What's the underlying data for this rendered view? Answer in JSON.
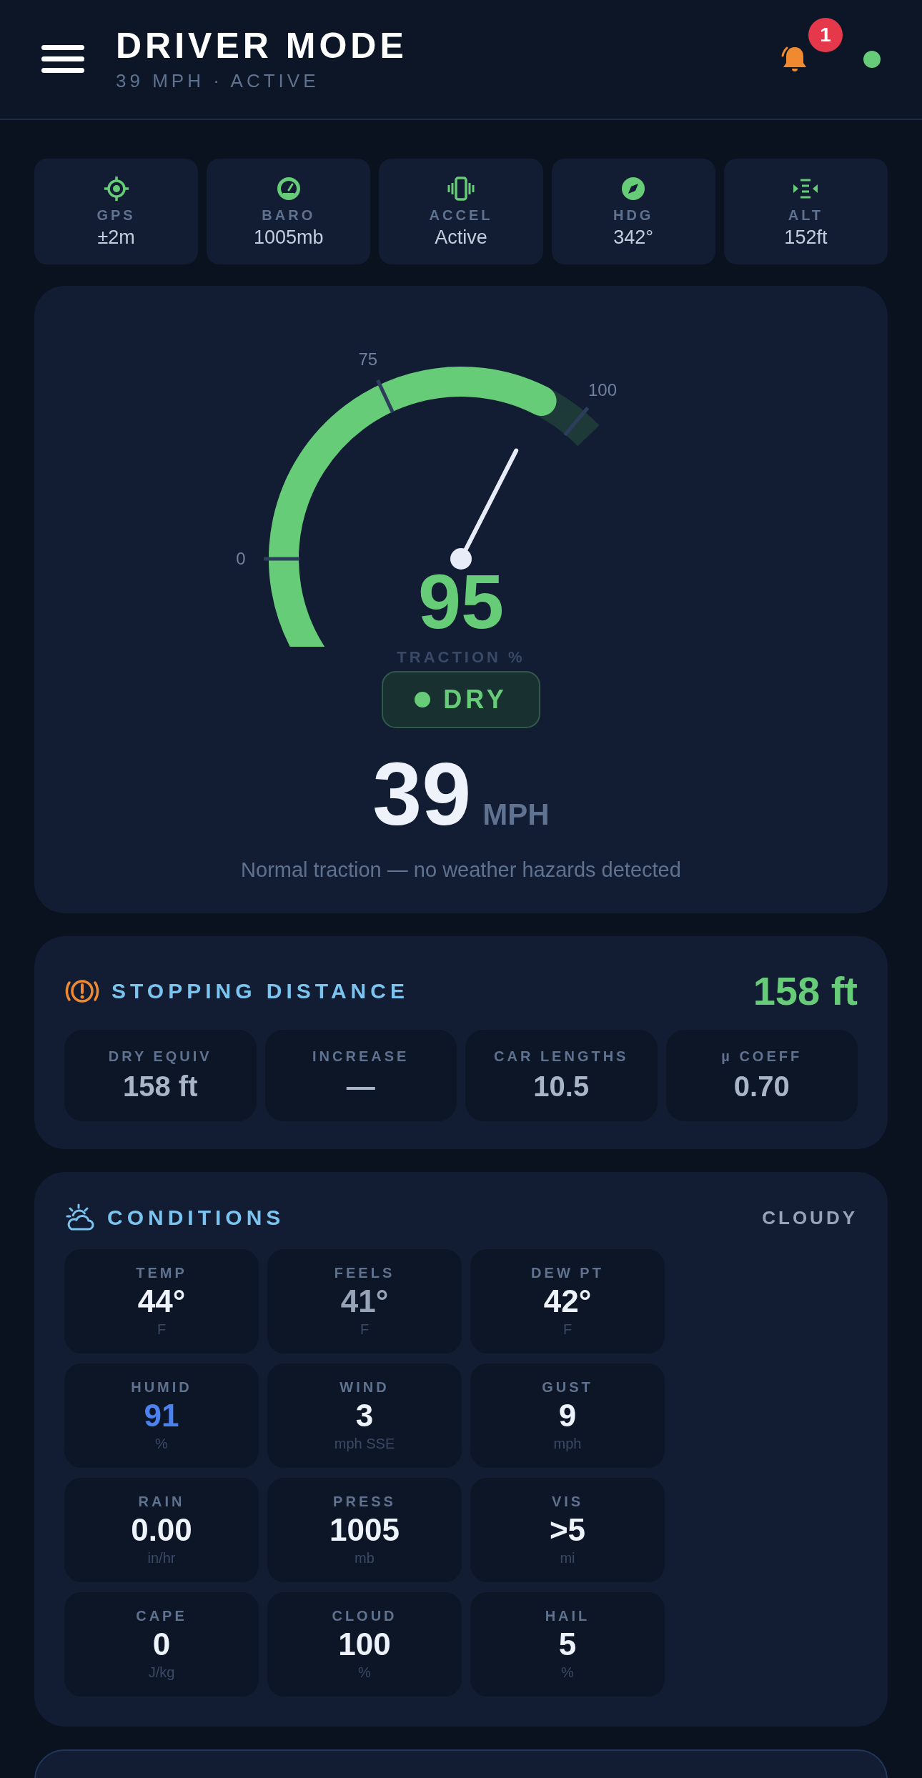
{
  "header": {
    "title": "DRIVER MODE",
    "subtitle": "39 MPH · ACTIVE",
    "notification_count": "1",
    "connected": true
  },
  "sensors": [
    {
      "kind": "gps",
      "label": "GPS",
      "value": "±2m"
    },
    {
      "kind": "baro",
      "label": "BARO",
      "value": "1005mb"
    },
    {
      "kind": "accel",
      "label": "ACCEL",
      "value": "Active"
    },
    {
      "kind": "hdg",
      "label": "HDG",
      "value": "342°"
    },
    {
      "kind": "alt",
      "label": "ALT",
      "value": "152ft"
    }
  ],
  "traction": {
    "value": "95",
    "level": 0.95,
    "label": "TRACTION %",
    "ticks": [
      "0",
      "75",
      "100"
    ],
    "surface": "DRY",
    "speed": "39",
    "speed_unit": "MPH",
    "message": "Normal traction — no weather hazards detected"
  },
  "stopping": {
    "title": "STOPPING DISTANCE",
    "total": "158 ft",
    "tiles": [
      {
        "label": "DRY EQUIV",
        "value": "158 ft"
      },
      {
        "label": "INCREASE",
        "value": "—"
      },
      {
        "label": "CAR LENGTHS",
        "value": "10.5"
      },
      {
        "label": "µ COEFF",
        "value": "0.70"
      }
    ]
  },
  "conditions": {
    "title": "CONDITIONS",
    "summary": "CLOUDY",
    "tiles": [
      {
        "label": "TEMP",
        "value": "44°",
        "unit": "F",
        "color": "#eef2fb"
      },
      {
        "label": "FEELS",
        "value": "41°",
        "unit": "F",
        "color": "#97a3b6"
      },
      {
        "label": "DEW PT",
        "value": "42°",
        "unit": "F",
        "color": "#eef2fb"
      },
      {
        "label": "HUMID",
        "value": "91",
        "unit": "%",
        "color": "#4b82f0"
      },
      {
        "label": "WIND",
        "value": "3",
        "unit": "mph SSE",
        "color": "#eef2fb"
      },
      {
        "label": "GUST",
        "value": "9",
        "unit": "mph",
        "color": "#eef2fb"
      },
      {
        "label": "RAIN",
        "value": "0.00",
        "unit": "in/hr",
        "color": "#eef2fb"
      },
      {
        "label": "PRESS",
        "value": "1005",
        "unit": "mb",
        "color": "#eef2fb"
      },
      {
        "label": "VIS",
        "value": ">5",
        "unit": "mi",
        "color": "#eef2fb"
      },
      {
        "label": "CAPE",
        "value": "0",
        "unit": "J/kg",
        "color": "#eef2fb"
      },
      {
        "label": "CLOUD",
        "value": "100",
        "unit": "%",
        "color": "#eef2fb"
      },
      {
        "label": "HAIL",
        "value": "5",
        "unit": "%",
        "color": "#eef2fb"
      }
    ]
  }
}
